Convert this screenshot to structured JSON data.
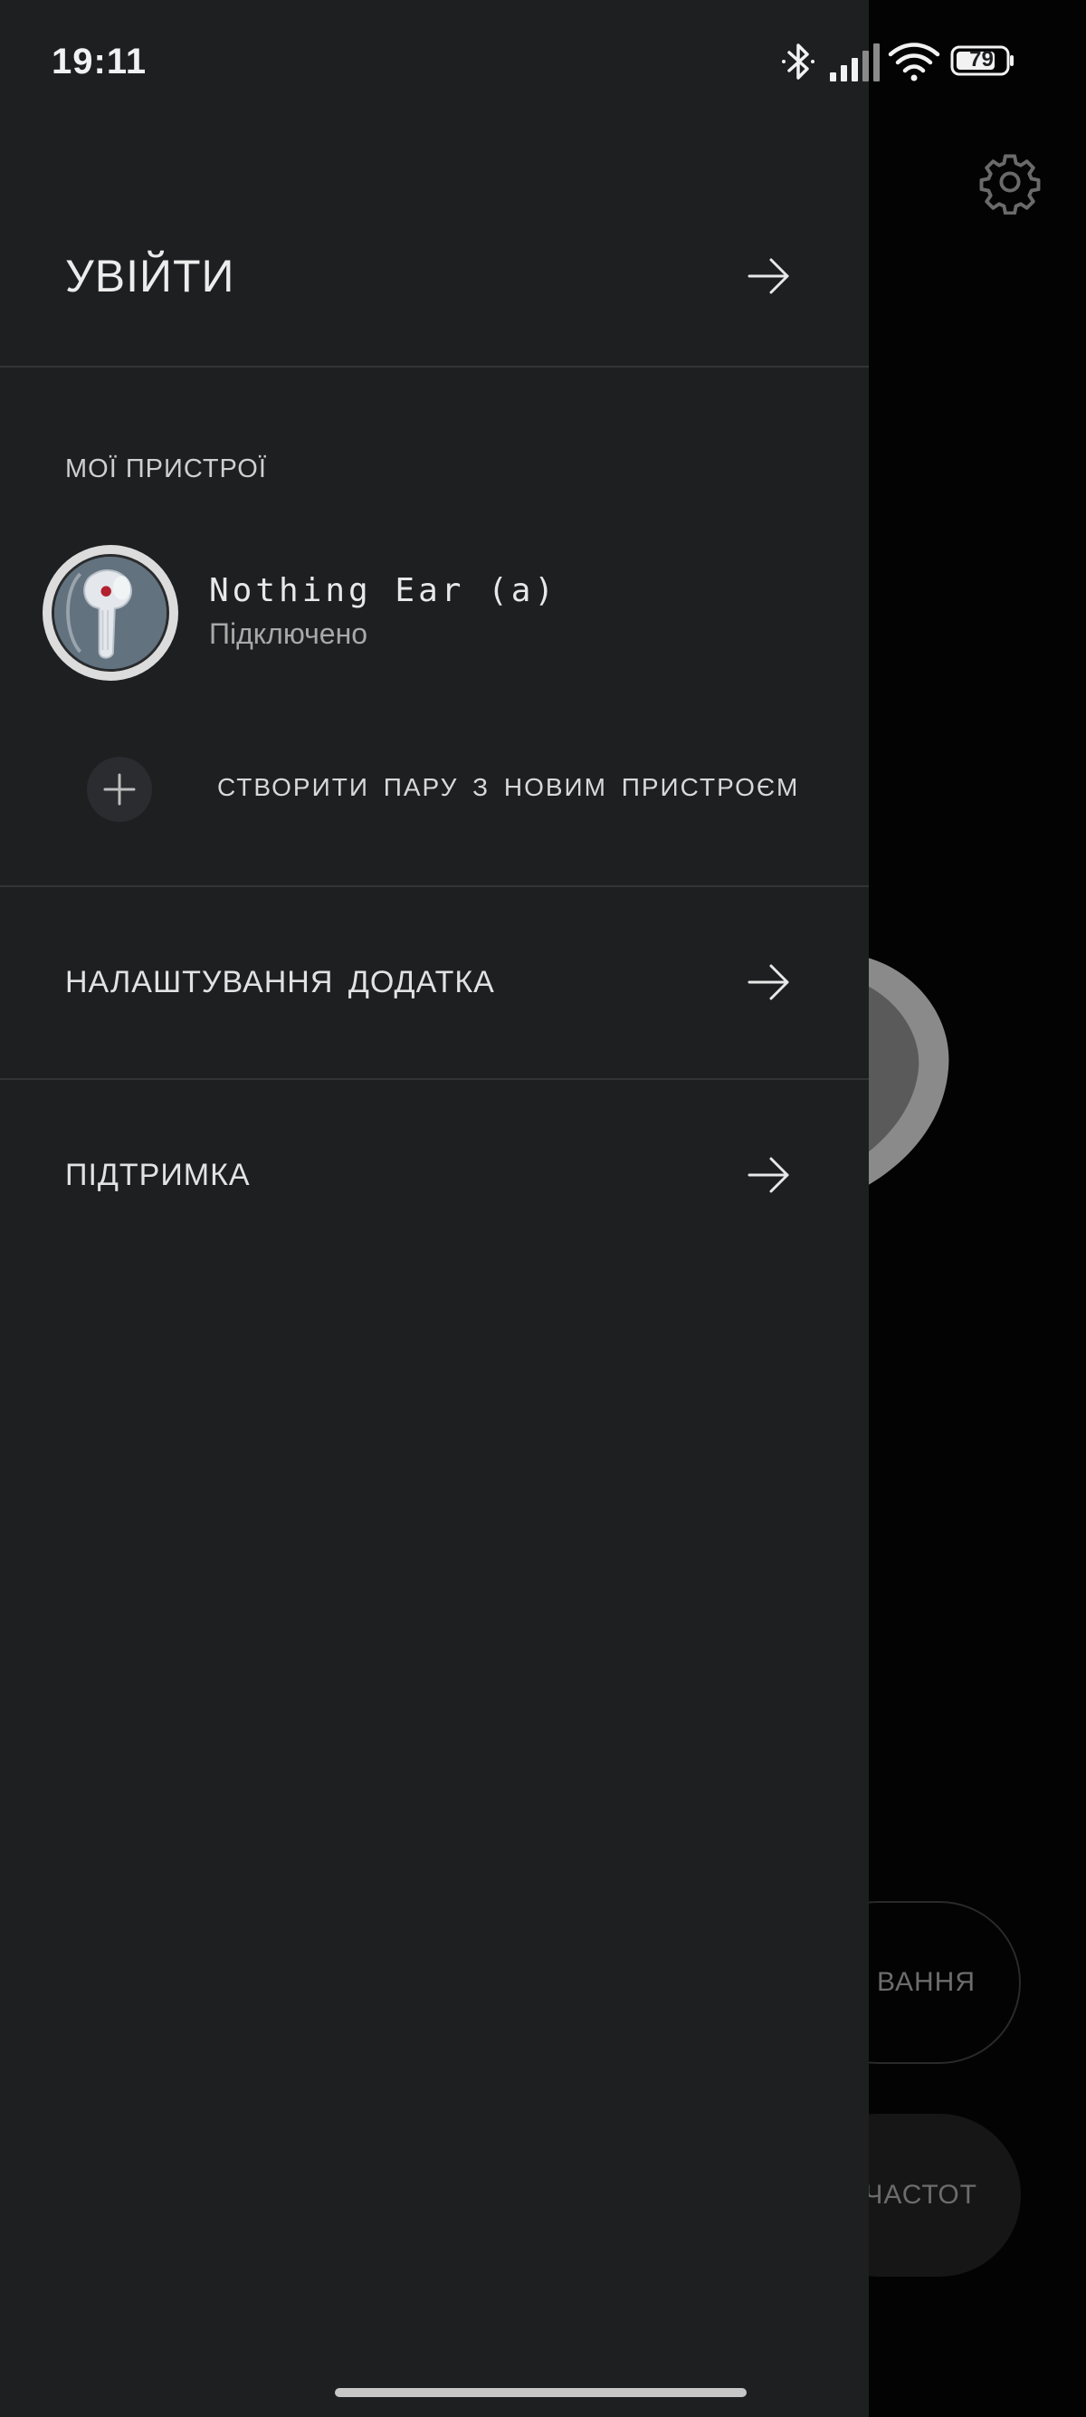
{
  "status_bar": {
    "time": "19:11",
    "battery_level": "79",
    "icons": [
      "bluetooth-icon",
      "signal-icon",
      "wifi-icon",
      "battery-icon"
    ]
  },
  "drawer": {
    "login_label": "УВІЙТИ",
    "devices_section_title": "МОЇ ПРИСТРОЇ",
    "devices": [
      {
        "name": "Nothing Ear (a)",
        "status": "Підключено",
        "icon": "earbud-image"
      }
    ],
    "pair_new_device_label": "СТВОРИТИ ПАРУ З НОВИМ ПРИСТРОЄМ",
    "menu": [
      {
        "label": "НАЛАШТУВАННЯ ДОДАТКА",
        "icon": "arrow-right-icon"
      },
      {
        "label": "ПІДТРИМКА",
        "icon": "arrow-right-icon"
      }
    ]
  },
  "background": {
    "pill_1_text": "ВАННЯ",
    "pill_2_text": "Х ЧАСТОТ",
    "icons": [
      "gear-icon",
      "earbud-image"
    ]
  },
  "colors": {
    "drawer_bg": "#1e1f21",
    "background": "#030303",
    "divider": "#333436",
    "text_primary": "#e8e8e8",
    "text_secondary": "#a9a9a9"
  }
}
